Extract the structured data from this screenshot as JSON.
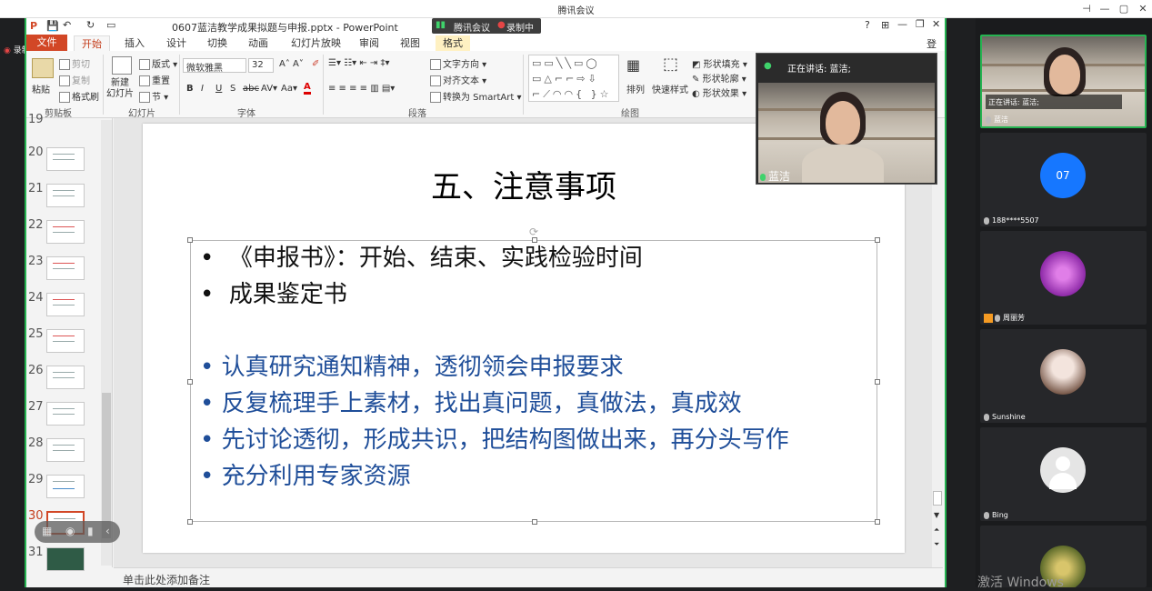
{
  "meeting": {
    "app_title": "腾讯会议",
    "meeting_badge": "腾讯会议",
    "recording_badge": "录制中",
    "record_indicator": "录制中",
    "watermark": "激活 Windows"
  },
  "ppt": {
    "doc_title": "0607蓝洁教学成果拟题与申报.pptx - PowerPoint",
    "login": "登录",
    "tabs": [
      "文件",
      "开始",
      "插入",
      "设计",
      "切换",
      "动画",
      "幻灯片放映",
      "审阅",
      "视图",
      "格式"
    ],
    "clipboard": {
      "paste": "粘贴",
      "cut": "剪切",
      "copy": "复制",
      "format_painter": "格式刷",
      "label": "剪贴板"
    },
    "slides_group": {
      "new_slide": "新建\n幻灯片",
      "layout": "版式",
      "reset": "重置",
      "section": "节",
      "label": "幻灯片"
    },
    "font": {
      "name": "微软雅黑",
      "size": "32",
      "label": "字体"
    },
    "paragraph": {
      "text_dir": "文字方向",
      "align_text": "对齐文本",
      "smartart": "转换为 SmartArt",
      "label": "段落"
    },
    "drawing": {
      "arrange": "排列",
      "quick_styles": "快速样式",
      "fill": "形状填充",
      "outline": "形状轮廓",
      "effects": "形状效果",
      "label": "绘图"
    },
    "thumb_numbers": [
      "19",
      "20",
      "21",
      "22",
      "23",
      "24",
      "25",
      "26",
      "27",
      "28",
      "29",
      "30",
      "31"
    ],
    "current_slide": "30",
    "notes_placeholder": "单击此处添加备注"
  },
  "slide": {
    "title": "五、注意事项",
    "bullets_black": [
      "《申报书》：开始、结束、实践检验时间",
      "成果鉴定书"
    ],
    "bullets_blue": [
      "认真研究通知精神，透彻领会申报要求",
      "反复梳理手上素材，找出真问题，真做法，真成效",
      "先讨论透彻，形成共识，把结构图做出来，再分头写作",
      "充分利用专家资源"
    ],
    "bullet_char": "•"
  },
  "speaker_popup": {
    "speaking_label": "正在讲话: 蓝洁;",
    "name": "蓝洁"
  },
  "participants": [
    {
      "name": "蓝洁",
      "speaking_label": "正在讲话: 蓝洁;",
      "type": "video"
    },
    {
      "name": "188****5507",
      "avatar_text": "07",
      "type": "avatar",
      "color": "#1677ff"
    },
    {
      "name": "周丽芳",
      "type": "avatar",
      "color": "#a63fc2"
    },
    {
      "name": "Sunshine",
      "type": "avatar",
      "color": "#e8d6d0"
    },
    {
      "name": "Bing",
      "type": "avatar",
      "color": "#d9d9d9"
    },
    {
      "name": "",
      "type": "avatar",
      "color": "#7a8b3a"
    }
  ],
  "colors": {
    "accent_green": "#25b351",
    "ppt_red": "#d24726",
    "bullet_blue": "#1f4e99"
  }
}
